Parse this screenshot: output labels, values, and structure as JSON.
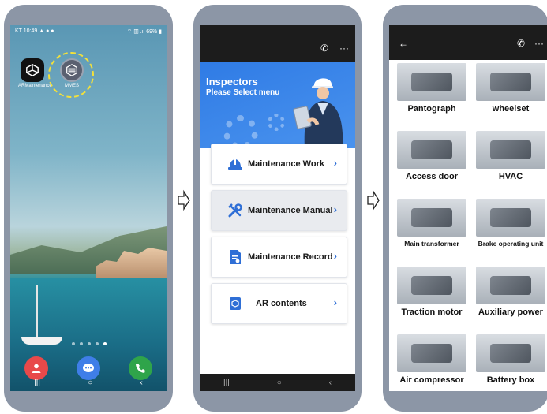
{
  "home": {
    "status_time": "KT 10:49",
    "status_icons": "▲ ● ●",
    "status_right": "⌔ ▥ .ıl 69% ▮",
    "apps": [
      {
        "label": "ARMaintenance"
      },
      {
        "label": "MMES"
      }
    ],
    "nav": [
      "|||",
      "○",
      "‹"
    ]
  },
  "menu_screen": {
    "hero_title": "Inspectors",
    "hero_subtitle": "Please Select menu",
    "items": [
      {
        "label": "Maintenance Work",
        "icon": "hardhat-icon",
        "selected": false
      },
      {
        "label": "Maintenance Manual",
        "icon": "tools-icon",
        "selected": true
      },
      {
        "label": "Maintenance Record",
        "icon": "record-icon",
        "selected": false
      },
      {
        "label": "AR contents",
        "icon": "ar-cube-icon",
        "selected": false
      }
    ],
    "chevron": "›",
    "nav": [
      "|||",
      "○",
      "‹"
    ]
  },
  "component_screen": {
    "back": "←",
    "components": [
      {
        "label": "Pantograph"
      },
      {
        "label": "wheelset"
      },
      {
        "label": "Access door"
      },
      {
        "label": "HVAC"
      },
      {
        "label": "Main transformer"
      },
      {
        "label": "Brake operating unit"
      },
      {
        "label": "Traction motor"
      },
      {
        "label": "Auxiliary power"
      },
      {
        "label": "Air compressor"
      },
      {
        "label": "Battery box"
      }
    ]
  },
  "toolbar": {
    "phone_icon": "✆",
    "more_icon": "···"
  },
  "colors": {
    "hero_blue": "#2f7be5",
    "chevron_blue": "#2f6fd6",
    "highlight_yellow": "#f4e13a",
    "frame_gray": "#8c96a6"
  }
}
